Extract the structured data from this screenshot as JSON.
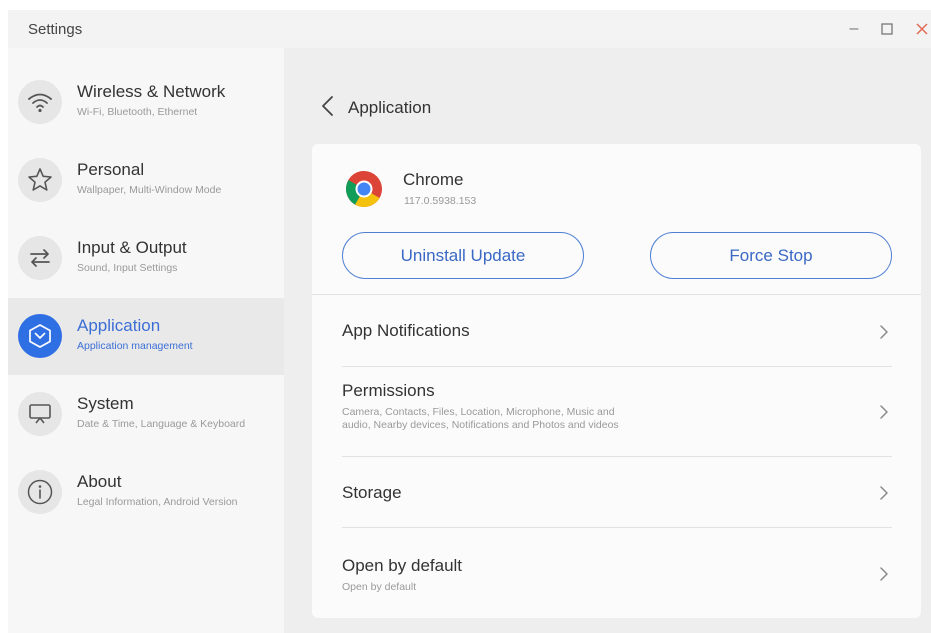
{
  "window": {
    "title": "Settings",
    "controls": {
      "minimize": "–",
      "maximize": "☐",
      "close": "✕"
    }
  },
  "sidebar": {
    "items": [
      {
        "label": "Wireless & Network",
        "sub": "Wi-Fi, Bluetooth, Ethernet",
        "icon": "wifi-icon",
        "active": false
      },
      {
        "label": "Personal",
        "sub": "Wallpaper, Multi-Window Mode",
        "icon": "star-icon",
        "active": false
      },
      {
        "label": "Input & Output",
        "sub": "Sound, Input Settings",
        "icon": "swap-arrows-icon",
        "active": false
      },
      {
        "label": "Application",
        "sub": "Application management",
        "icon": "application-hexagon-icon",
        "active": true
      },
      {
        "label": "System",
        "sub": "Date & Time, Language & Keyboard",
        "icon": "monitor-icon",
        "active": false
      },
      {
        "label": "About",
        "sub": "Legal Information, Android Version",
        "icon": "info-icon",
        "active": false
      }
    ]
  },
  "main": {
    "title": "Application",
    "back_icon": "chevron-left-icon",
    "app": {
      "name": "Chrome",
      "version": "117.0.5938.153",
      "icon": "chrome-icon"
    },
    "buttons": {
      "uninstall": "Uninstall Update",
      "force_stop": "Force Stop"
    },
    "rows": [
      {
        "label": "App Notifications",
        "sub": ""
      },
      {
        "label": "Permissions",
        "sub": "Camera, Contacts, Files, Location, Microphone, Music and audio, Nearby devices, Notifications and Photos and videos"
      },
      {
        "label": "Storage",
        "sub": ""
      },
      {
        "label": "Open by default",
        "sub": "Open by default"
      }
    ]
  },
  "colors": {
    "accent": "#2f6fe4",
    "accent_text": "#3c6fd6",
    "button_border": "#4f7fd3",
    "close": "#e26a55"
  }
}
